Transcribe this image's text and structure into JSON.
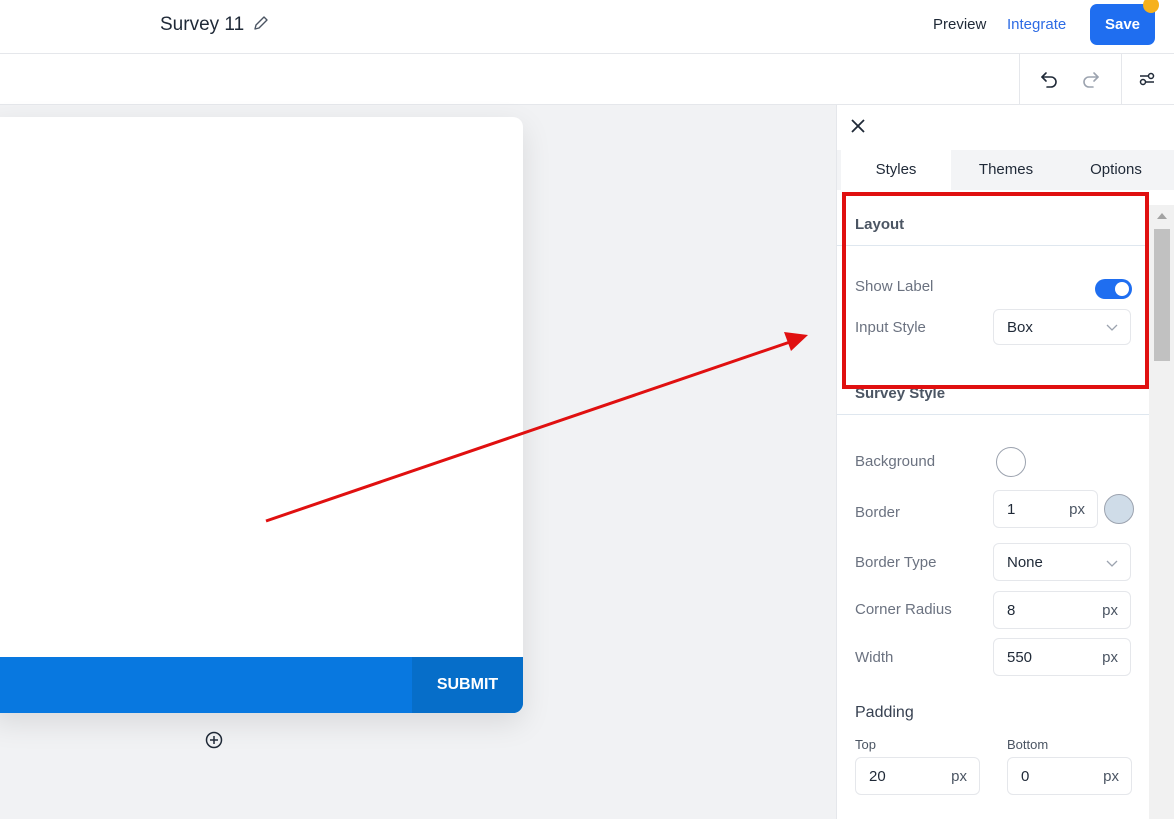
{
  "header": {
    "title": "Survey 11",
    "preview_label": "Preview",
    "integrate_label": "Integrate",
    "save_label": "Save"
  },
  "canvas": {
    "submit_label": "SUBMIT"
  },
  "panel": {
    "tabs": [
      {
        "label": "Styles",
        "active": true
      },
      {
        "label": "Themes",
        "active": false
      },
      {
        "label": "Options",
        "active": false
      }
    ],
    "layout": {
      "title": "Layout",
      "show_label": "Show Label",
      "show_label_on": true,
      "input_style_label": "Input Style",
      "input_style_value": "Box"
    },
    "survey_style": {
      "title": "Survey Style",
      "background_label": "Background",
      "background_color": "#ffffff",
      "border_label": "Border",
      "border_value": "1",
      "border_unit": "px",
      "border_color": "#cfdce8",
      "border_type_label": "Border Type",
      "border_type_value": "None",
      "corner_radius_label": "Corner Radius",
      "corner_radius_value": "8",
      "corner_radius_unit": "px",
      "width_label": "Width",
      "width_value": "550",
      "width_unit": "px"
    },
    "padding": {
      "title": "Padding",
      "top_label": "Top",
      "top_value": "20",
      "top_unit": "px",
      "bottom_label": "Bottom",
      "bottom_value": "0",
      "bottom_unit": "px"
    }
  },
  "colors": {
    "accent": "#1f6ef0",
    "submit_bar": "#0878e0",
    "annotation": "#e01010"
  }
}
